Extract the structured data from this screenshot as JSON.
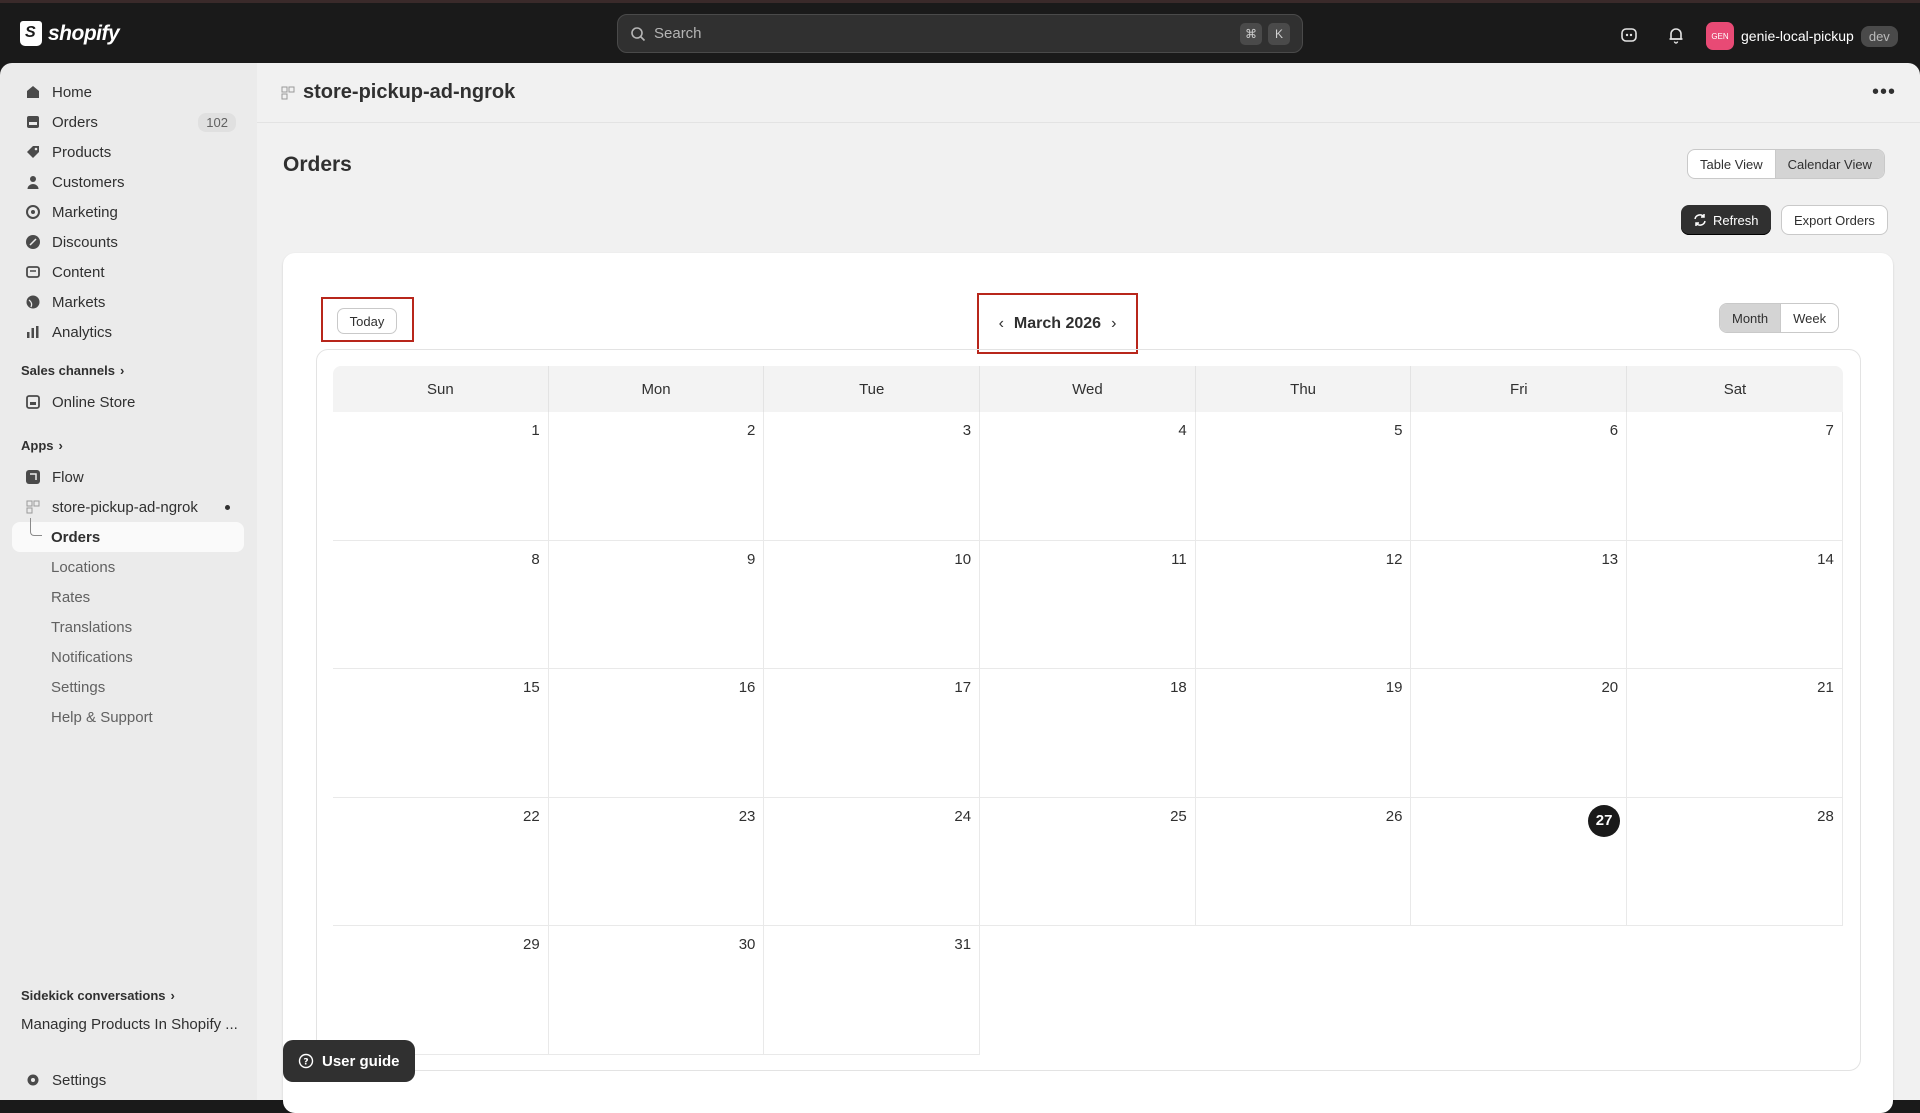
{
  "topbar": {
    "logo_text": "shopify",
    "search_placeholder": "Search",
    "shortcut_keys": [
      "⌘",
      "K"
    ],
    "store_avatar": "GEN",
    "store_name": "genie-local-pickup",
    "env_badge": "dev"
  },
  "sidebar": {
    "main_items": [
      {
        "label": "Home",
        "icon": "home-icon"
      },
      {
        "label": "Orders",
        "icon": "orders-icon",
        "count": "102"
      },
      {
        "label": "Products",
        "icon": "tag-icon"
      },
      {
        "label": "Customers",
        "icon": "person-icon"
      },
      {
        "label": "Marketing",
        "icon": "target-icon"
      },
      {
        "label": "Discounts",
        "icon": "discount-icon"
      },
      {
        "label": "Content",
        "icon": "content-icon"
      },
      {
        "label": "Markets",
        "icon": "globe-icon"
      },
      {
        "label": "Analytics",
        "icon": "chart-icon"
      }
    ],
    "sales_channels_label": "Sales channels",
    "online_store_label": "Online Store",
    "apps_label": "Apps",
    "flow_label": "Flow",
    "app_name": "store-pickup-ad-ngrok",
    "app_sub_items": [
      "Orders",
      "Locations",
      "Rates",
      "Translations",
      "Notifications",
      "Settings",
      "Help & Support"
    ],
    "sidekick_label": "Sidekick conversations",
    "sidekick_item": "Managing Products In Shopify ...",
    "settings_label": "Settings"
  },
  "main": {
    "app_title": "store-pickup-ad-ngrok",
    "page_title": "Orders",
    "view_toggle": [
      "Table View",
      "Calendar View"
    ],
    "selected_view": "Calendar View",
    "refresh_label": "Refresh",
    "export_label": "Export Orders",
    "today_label": "Today",
    "month_label": "March 2026",
    "range_toggle": [
      "Month",
      "Week"
    ],
    "selected_range": "Month",
    "weekdays": [
      "Sun",
      "Mon",
      "Tue",
      "Wed",
      "Thu",
      "Fri",
      "Sat"
    ],
    "weeks": [
      [
        "1",
        "2",
        "3",
        "4",
        "5",
        "6",
        "7"
      ],
      [
        "8",
        "9",
        "10",
        "11",
        "12",
        "13",
        "14"
      ],
      [
        "15",
        "16",
        "17",
        "18",
        "19",
        "20",
        "21"
      ],
      [
        "22",
        "23",
        "24",
        "25",
        "26",
        "27",
        "28"
      ],
      [
        "29",
        "30",
        "31",
        "",
        "",
        "",
        ""
      ]
    ],
    "today_date": "27",
    "user_guide_label": "User guide"
  },
  "colors": {
    "topbar_bg": "#1a1a1a",
    "highlight_border": "#b8261b",
    "today_circle": "#1a1a1a",
    "avatar_bg": "#e84a75"
  }
}
